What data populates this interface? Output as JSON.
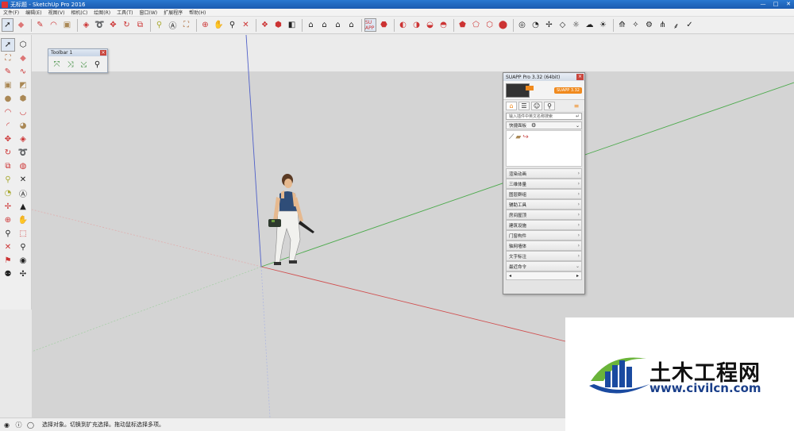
{
  "window": {
    "title": "无标题 - SketchUp Pro 2016",
    "controls": [
      "—",
      "□",
      "✕"
    ]
  },
  "menu": [
    "文件(F)",
    "编辑(E)",
    "视图(V)",
    "相机(C)",
    "绘图(R)",
    "工具(T)",
    "窗口(W)",
    "扩展程序",
    "帮助(H)"
  ],
  "toolbar_icons": [
    "select-arrow",
    "eraser",
    "line-pencil",
    "arc",
    "rectangle",
    "push-pull",
    "follow-me",
    "move",
    "rotate",
    "scale",
    "offset",
    "tape-measure",
    "text",
    "paint-bucket",
    "orbit",
    "pan",
    "zoom",
    "zoom-extents",
    "components",
    "3d-warehouse",
    "section",
    "views-iso",
    "views-top",
    "views-front",
    "views-right",
    "views-back",
    "suapp",
    "styles-xray",
    "shadows",
    "fog",
    "match-photo",
    "sandbox"
  ],
  "toolbar_badge": {
    "text": "SU APP"
  },
  "floating_toolbar": {
    "title": "Toolbar 1",
    "close": "×"
  },
  "suapp": {
    "title": "SUAPP Pro 3.32 (64bit)",
    "close": "×",
    "version_badge": "SUAPP 3.32",
    "search_placeholder": "输入插件中英文名称搜索",
    "quick_panel_label": "快捷面板",
    "categories": [
      "渲染动画",
      "三维体量",
      "图层群组",
      "辅助工具",
      "房间屋顶",
      "建筑设施",
      "门窗构件",
      "轴网墙体",
      "文字标注",
      "最近命令"
    ]
  },
  "status": {
    "text": "选择对象。切换到扩充选择。拖动鼠标选择多项。"
  },
  "watermark": {
    "chinese": "土木工程网",
    "url": "www.civilcn.com"
  },
  "colors": {
    "accent_orange": "#f08a1e",
    "title_blue": "#1b5bb0",
    "axis_red": "#d05050",
    "axis_green": "#4caa4c",
    "axis_blue": "#5060c8"
  }
}
